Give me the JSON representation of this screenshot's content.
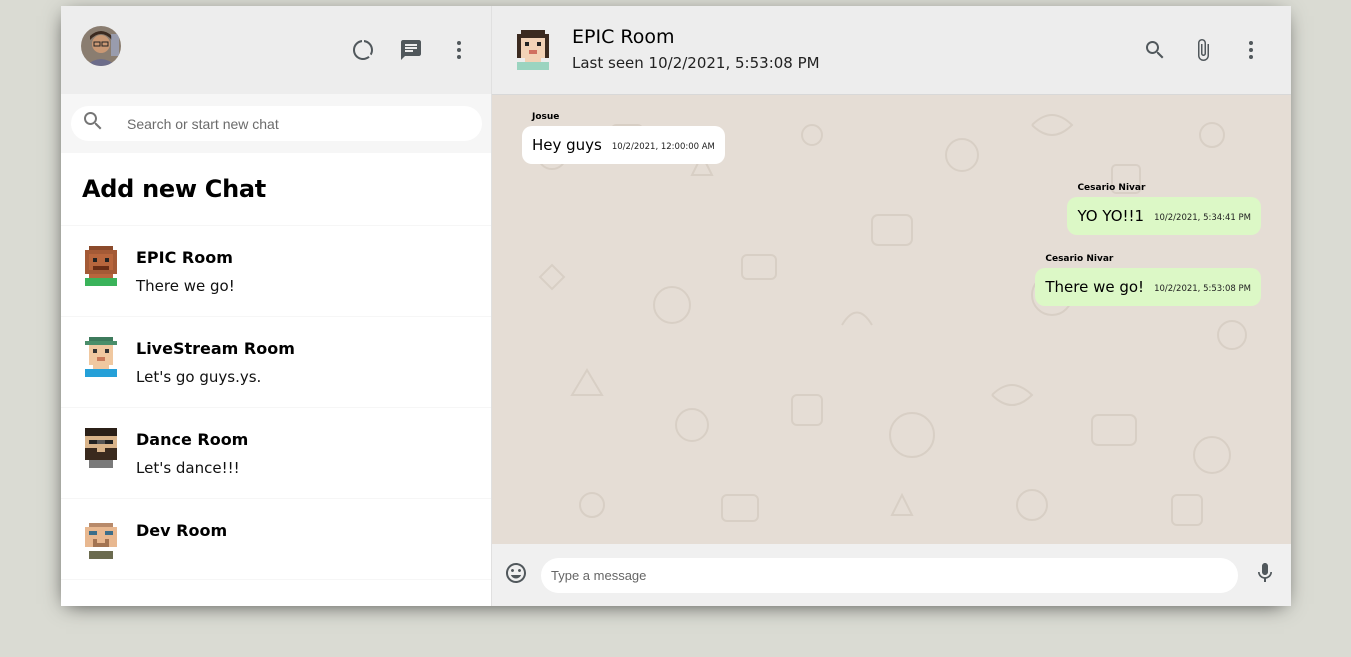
{
  "sidebar": {
    "search_placeholder": "Search or start new chat",
    "add_new_chat": "Add new Chat",
    "chats": [
      {
        "name": "EPIC Room",
        "last_message": "There we go!",
        "avatar": "pixel-avatar-brown"
      },
      {
        "name": "LiveStream Room",
        "last_message": "Let's go guys.ys.",
        "avatar": "pixel-avatar-hat"
      },
      {
        "name": "Dance Room",
        "last_message": "Let's dance!!!",
        "avatar": "pixel-avatar-beard"
      },
      {
        "name": "Dev Room",
        "last_message": "",
        "avatar": "pixel-avatar-bald"
      }
    ]
  },
  "chat": {
    "room_name": "EPIC Room",
    "last_seen": "Last seen 10/2/2021, 5:53:08 PM",
    "messages": [
      {
        "sender": "Josue",
        "text": "Hey guys",
        "time": "10/2/2021, 12:00:00 AM",
        "sent": false
      },
      {
        "sender": "Cesario Nivar",
        "text": "YO YO!!1",
        "time": "10/2/2021, 5:34:41 PM",
        "sent": true
      },
      {
        "sender": "Cesario Nivar",
        "text": "There we go!",
        "time": "10/2/2021, 5:53:08 PM",
        "sent": true
      }
    ],
    "input_placeholder": "Type a message"
  },
  "colors": {
    "background": "#dadbd3",
    "header": "#ededed",
    "sent_bubble": "#dcf8c6",
    "received_bubble": "#ffffff",
    "chat_wallpaper": "#e5ddd5"
  }
}
